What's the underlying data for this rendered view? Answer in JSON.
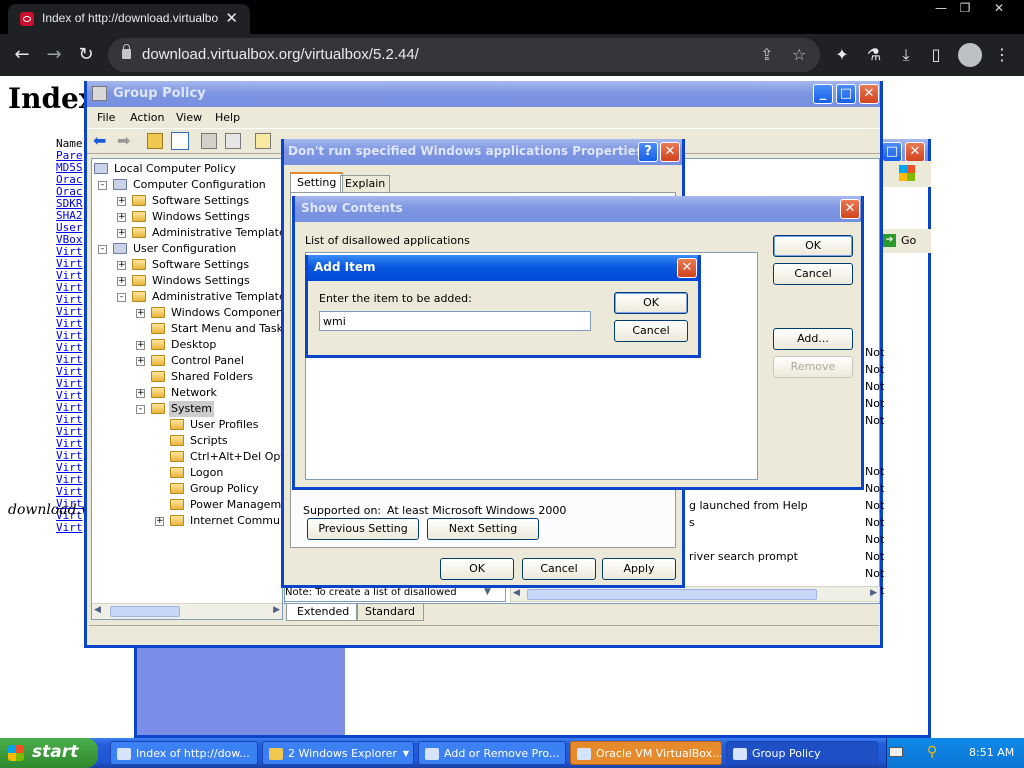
{
  "browser": {
    "tab_title": "Index of http://download.virtualbo",
    "url": "download.virtualbox.org/virtualbox/5.2.44/"
  },
  "webpage": {
    "heading": "Index",
    "name_col": "Name",
    "links": [
      "Pare",
      "MD5S",
      "Orac",
      "Orac",
      "SDKR",
      "SHA2",
      "User",
      "VBox",
      "Virt",
      "Virt",
      "Virt",
      "Virt",
      "Virt",
      "Virt",
      "Virt",
      "Virt",
      "Virt",
      "Virt",
      "Virt",
      "Virt",
      "Virt",
      "Virt",
      "Virt",
      "Virt",
      "Virt",
      "Virt",
      "Virt",
      "Virt",
      "Virt",
      "Virt",
      "Virt",
      "Virt"
    ],
    "footer": "download.v"
  },
  "group_policy": {
    "title": "Group Policy",
    "menu": [
      "File",
      "Action",
      "View",
      "Help"
    ],
    "tree": [
      "Local Computer Policy",
      "Computer Configuration",
      "Software Settings",
      "Windows Settings",
      "Administrative Templates",
      "User Configuration",
      "Software Settings",
      "Windows Settings",
      "Administrative Templates",
      "Windows Components",
      "Start Menu and Taskba",
      "Desktop",
      "Control Panel",
      "Shared Folders",
      "Network",
      "System",
      "User Profiles",
      "Scripts",
      "Ctrl+Alt+Del Optio",
      "Logon",
      "Group Policy",
      "Power Managemen",
      "Internet Communic"
    ],
    "right_items": [
      "g launched from Help",
      "s",
      "river search prompt"
    ],
    "not_col": [
      "Not",
      "Not",
      "Not",
      "Not",
      "Not",
      "Not",
      "Not",
      "Not",
      "Not",
      "Not",
      "Not",
      "Not",
      "Not"
    ],
    "note": "Note: To create a list of disallowed",
    "tabs": [
      "Extended",
      "Standard"
    ]
  },
  "bg_window": {
    "go_label": "Go"
  },
  "properties": {
    "title": "Don't run specified Windows applications Properties",
    "tabs": [
      "Setting",
      "Explain"
    ],
    "supported_label": "Supported on:",
    "supported_value": "At least Microsoft Windows 2000",
    "prev": "Previous Setting",
    "next": "Next Setting",
    "ok": "OK",
    "cancel": "Cancel",
    "apply": "Apply"
  },
  "show_contents": {
    "title": "Show Contents",
    "list_label": "List of disallowed applications",
    "ok": "OK",
    "cancel": "Cancel",
    "add": "Add...",
    "remove": "Remove"
  },
  "add_item": {
    "title": "Add Item",
    "prompt": "Enter the item to be added:",
    "value": "wmi",
    "ok": "OK",
    "cancel": "Cancel"
  },
  "taskbar": {
    "start": "start",
    "tasks": [
      "Index of http://dow...",
      "2 Windows Explorer",
      "Add or Remove Pro...",
      "Oracle VM VirtualBox...",
      "Group Policy"
    ],
    "clock": "8:51 AM"
  },
  "colors": {
    "xp_blue": "#0a58e0",
    "start_green": "#3c9b3c",
    "active_task": "#e58b2b"
  }
}
